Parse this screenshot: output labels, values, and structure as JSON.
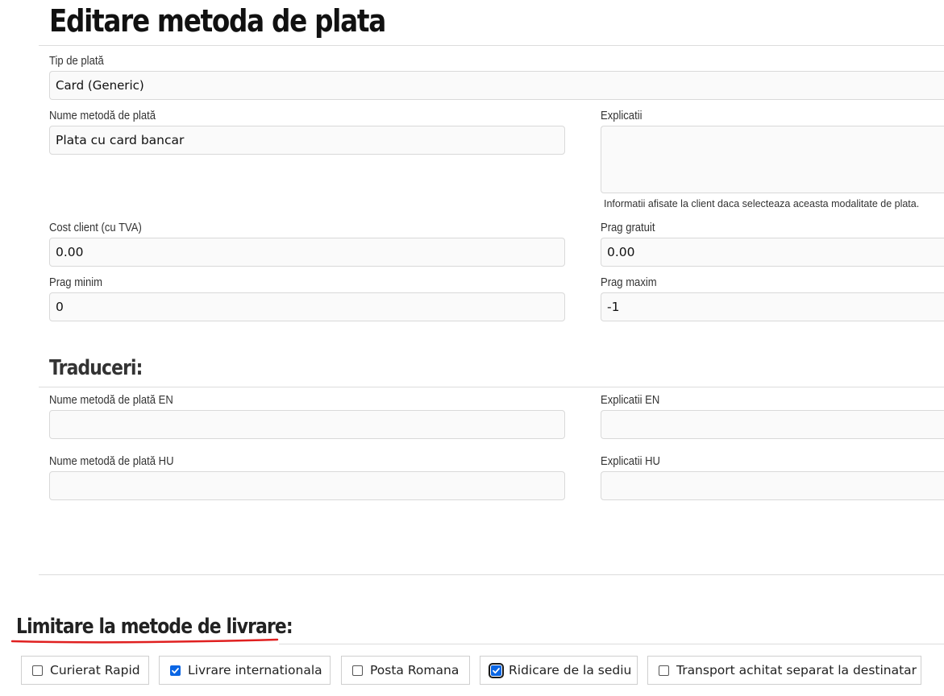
{
  "page": {
    "title": "Editare metoda de plata"
  },
  "form": {
    "payment_type": {
      "label": "Tip de plată",
      "value": "Card (Generic)"
    },
    "method_name": {
      "label": "Nume metodă de plată",
      "value": "Plata cu card bancar"
    },
    "explanations": {
      "label": "Explicatii",
      "value": "",
      "hint": "Informatii afisate la client daca selecteaza aceasta modalitate de plata."
    },
    "client_cost": {
      "label": "Cost client (cu TVA)",
      "value": "0.00"
    },
    "free_threshold": {
      "label": "Prag gratuit",
      "value": "0.00"
    },
    "min_threshold": {
      "label": "Prag minim",
      "value": "0"
    },
    "max_threshold": {
      "label": "Prag maxim",
      "value": "-1"
    }
  },
  "translations": {
    "title": "Traduceri:",
    "name_en": {
      "label": "Nume metodă de plată EN",
      "value": ""
    },
    "explanations_en": {
      "label": "Explicatii EN",
      "value": ""
    },
    "name_hu": {
      "label": "Nume metodă de plată HU",
      "value": ""
    },
    "explanations_hu": {
      "label": "Explicatii HU",
      "value": ""
    }
  },
  "delivery_limits": {
    "title": "Limitare la metode de livrare:",
    "underline_color": "#e02020",
    "checked_color": "#0b66e4",
    "options": [
      {
        "label": "Curierat Rapid",
        "checked": false
      },
      {
        "label": "Livrare internationala",
        "checked": true
      },
      {
        "label": "Posta Romana",
        "checked": false
      },
      {
        "label": "Ridicare de la sediu",
        "checked": true,
        "focused": true
      },
      {
        "label": "Transport achitat separat la destinatar",
        "checked": false
      }
    ]
  }
}
